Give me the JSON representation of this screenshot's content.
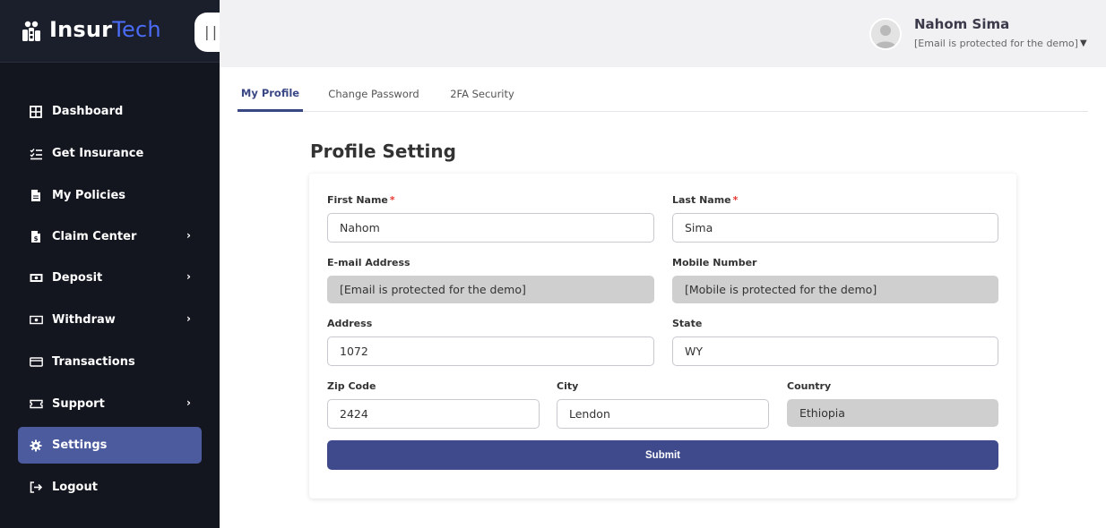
{
  "brand": {
    "part1": "Insur",
    "part2": "Tech",
    "collapse_glyph": "|||"
  },
  "user": {
    "name": "Nahom Sima",
    "email": "[Email is protected for the demo]"
  },
  "sidebar": {
    "items": [
      {
        "label": "Dashboard",
        "icon": "grid-icon",
        "has_chevron": false
      },
      {
        "label": "Get Insurance",
        "icon": "checklist-icon",
        "has_chevron": false
      },
      {
        "label": "My Policies",
        "icon": "document-icon",
        "has_chevron": false
      },
      {
        "label": "Claim Center",
        "icon": "claim-document-icon",
        "has_chevron": true
      },
      {
        "label": "Deposit",
        "icon": "money-icon",
        "has_chevron": true
      },
      {
        "label": "Withdraw",
        "icon": "cash-icon",
        "has_chevron": true
      },
      {
        "label": "Transactions",
        "icon": "card-icon",
        "has_chevron": false
      },
      {
        "label": "Support",
        "icon": "ticket-icon",
        "has_chevron": true
      },
      {
        "label": "Settings",
        "icon": "gear-icon",
        "has_chevron": false,
        "active": true
      },
      {
        "label": "Logout",
        "icon": "logout-icon",
        "has_chevron": false
      }
    ]
  },
  "tabs": [
    {
      "label": "My Profile",
      "active": true
    },
    {
      "label": "Change Password",
      "active": false
    },
    {
      "label": "2FA Security",
      "active": false
    }
  ],
  "page": {
    "title": "Profile Setting"
  },
  "form": {
    "first_name": {
      "label": "First Name",
      "required": "*",
      "value": "Nahom"
    },
    "last_name": {
      "label": "Last Name",
      "required": "*",
      "value": "Sima"
    },
    "email": {
      "label": "E-mail Address",
      "value": "[Email is protected for the demo]"
    },
    "mobile": {
      "label": "Mobile Number",
      "value": "[Mobile is protected for the demo]"
    },
    "address": {
      "label": "Address",
      "value": "1072"
    },
    "state": {
      "label": "State",
      "value": "WY"
    },
    "zip": {
      "label": "Zip Code",
      "value": "2424"
    },
    "city": {
      "label": "City",
      "value": "Lendon"
    },
    "country": {
      "label": "Country",
      "value": "Ethiopia"
    },
    "submit_label": "Submit"
  },
  "colors": {
    "sidebar_bg": "#13151f",
    "accent": "#3f4a8c",
    "active_nav": "#4c5a9e",
    "required": "#e53935"
  }
}
